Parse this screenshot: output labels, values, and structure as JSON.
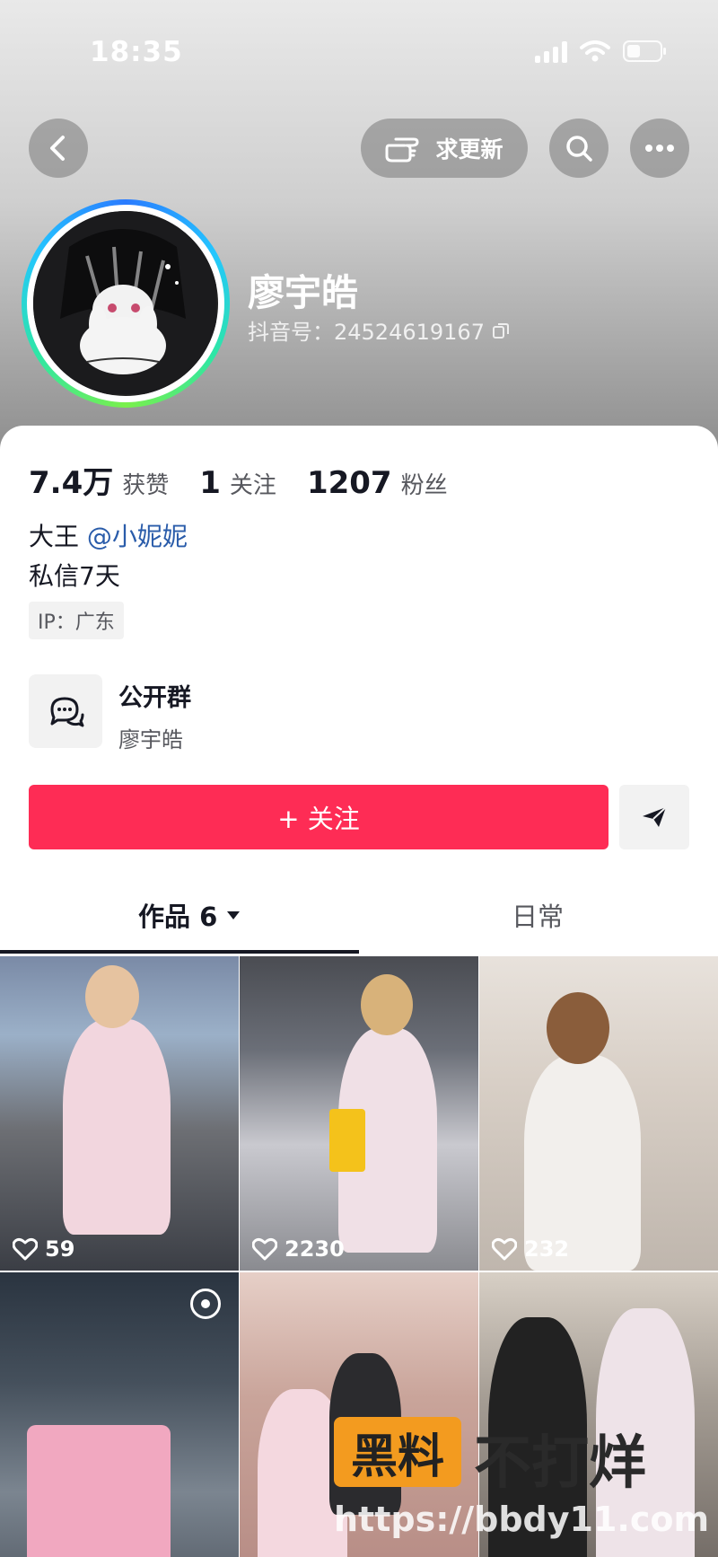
{
  "status_bar": {
    "time": "18:35"
  },
  "header": {
    "request_update_label": "求更新",
    "name": "廖宇皓",
    "douyin_id": "抖音号：24524619167"
  },
  "stats": {
    "likes_value": "7.4万",
    "likes_label": "获赞",
    "following_value": "1",
    "following_label": "关注",
    "followers_value": "1207",
    "followers_label": "粉丝"
  },
  "bio": {
    "line1_prefix": "大王 ",
    "line1_mention": "@小妮妮",
    "line2": "私信7天",
    "ip": "IP：广东"
  },
  "group": {
    "title": "公开群",
    "subtitle": "廖宇皓"
  },
  "actions": {
    "follow_label": "+ 关注"
  },
  "tabs": {
    "works_label": "作品 6",
    "daily_label": "日常"
  },
  "videos": [
    {
      "likes": "59"
    },
    {
      "likes": "2230"
    },
    {
      "likes": "232"
    },
    {
      "likes": ""
    },
    {
      "likes": ""
    },
    {
      "likes": ""
    }
  ],
  "watermark": {
    "badge": "黑料",
    "text": "不打烊",
    "url": "https://bbdy11.com"
  },
  "colors": {
    "primary": "#fe2c55",
    "mention": "#2a5caa",
    "text": "#161823"
  }
}
